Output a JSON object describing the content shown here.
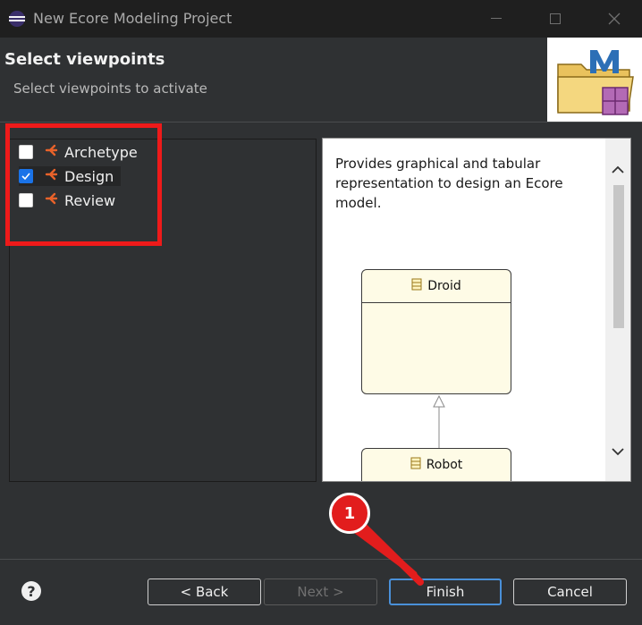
{
  "window": {
    "title": "New Ecore Modeling Project"
  },
  "header": {
    "title": "Select viewpoints",
    "subtitle": "Select viewpoints to activate"
  },
  "viewpoints": [
    {
      "label": "Archetype",
      "checked": false
    },
    {
      "label": "Design",
      "checked": true
    },
    {
      "label": "Review",
      "checked": false
    }
  ],
  "details": {
    "description": "Provides graphical and tabular representation to design an Ecore model.",
    "classes": [
      "Droid",
      "Robot"
    ]
  },
  "buttons": {
    "back": "< Back",
    "next": "Next >",
    "finish": "Finish",
    "cancel": "Cancel"
  },
  "annotation": {
    "step": "1"
  },
  "colors": {
    "highlight": "#ee1a1a",
    "accent": "#4a90d9",
    "viewpoint_icon": "#e8622a"
  }
}
